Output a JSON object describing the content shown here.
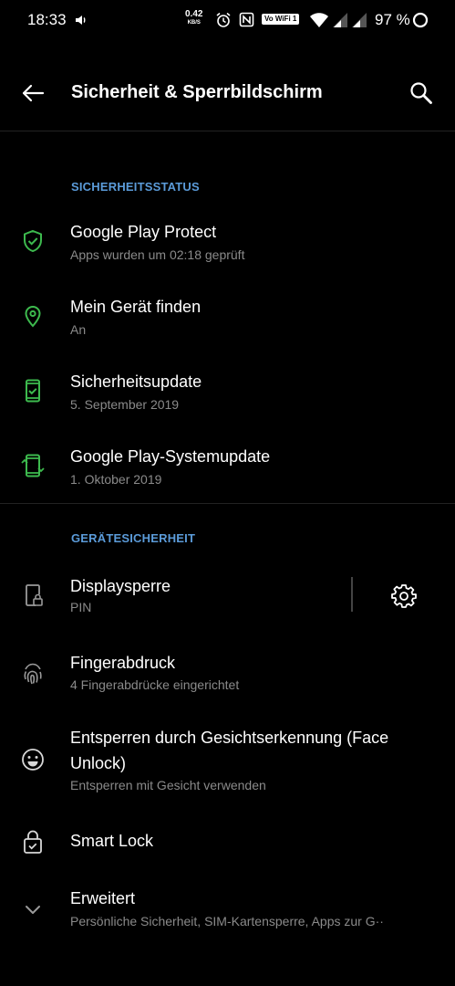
{
  "status_bar": {
    "time": "18:33",
    "speed_value": "0.42",
    "speed_unit": "KB/S",
    "volte_label": "Vo WiFi 1",
    "battery": "97 %"
  },
  "app_bar": {
    "title": "Sicherheit & Sperrbildschirm"
  },
  "sections": {
    "security_status": {
      "header": "SICHERHEITSSTATUS",
      "items": [
        {
          "title": "Google Play Protect",
          "subtitle": "Apps wurden um 02:18 geprüft",
          "icon": "shield-check-icon"
        },
        {
          "title": "Mein Gerät finden",
          "subtitle": "An",
          "icon": "location-pin-icon"
        },
        {
          "title": "Sicherheitsupdate",
          "subtitle": "5. September 2019",
          "icon": "phone-check-icon"
        },
        {
          "title": "Google Play-Systemupdate",
          "subtitle": "1. Oktober 2019",
          "icon": "phone-sync-icon"
        }
      ]
    },
    "device_security": {
      "header": "GERÄTESICHERHEIT",
      "items": [
        {
          "title": "Displaysperre",
          "subtitle": "PIN",
          "icon": "phone-lock-icon"
        },
        {
          "title": "Fingerabdruck",
          "subtitle": "4 Fingerabdrücke eingerichtet",
          "icon": "fingerprint-icon"
        },
        {
          "title": "Entsperren durch Gesichtserkennung (Face Unlock)",
          "subtitle": "Entsperren mit Gesicht verwenden",
          "icon": "face-icon"
        },
        {
          "title": "Smart Lock",
          "subtitle": "",
          "icon": "lock-check-icon"
        },
        {
          "title": "Erweitert",
          "subtitle": "Persönliche Sicherheit, SIM-Kartensperre, Apps zur G··",
          "icon": "chevron-down-icon"
        }
      ]
    }
  },
  "colors": {
    "accent_green": "#3dba4e",
    "header_blue": "#5b9bd9",
    "icon_gray": "#9a9a9a"
  }
}
